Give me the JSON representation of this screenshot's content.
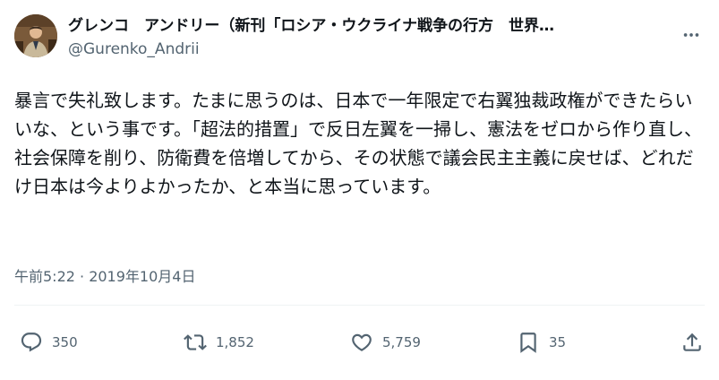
{
  "author": {
    "display_name": "グレンコ　アンドリー（新刊「ロシア・ウクライナ戦争の行方　世界…",
    "handle": "@Gurenko_Andrii"
  },
  "tweet": {
    "text": "暴言で失礼致します。たまに思うのは、日本で一年限定で右翼独裁政権ができたらいいな、という事です。「超法的措置」で反日左翼を一掃し、憲法をゼロから作り直し、社会保障を削り、防衛費を倍増してから、その状態で議会民主主義に戻せば、どれだけ日本は今よりよかったか、と本当に思っています。",
    "timestamp": "午前5:22 · 2019年10月4日"
  },
  "metrics": {
    "replies": "350",
    "retweets": "1,852",
    "likes": "5,759",
    "bookmarks": "35"
  },
  "icons": {
    "more": "more-horizontal-icon",
    "reply": "speech-bubble-icon",
    "retweet": "retweet-arrows-icon",
    "like": "heart-icon",
    "bookmark": "bookmark-icon",
    "share": "share-upload-icon"
  },
  "colors": {
    "text": "#0f1419",
    "secondary": "#536471",
    "divider": "#eff3f4",
    "background": "#ffffff"
  }
}
